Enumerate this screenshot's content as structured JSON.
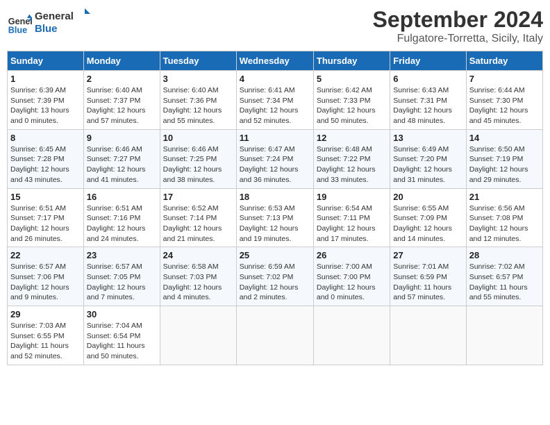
{
  "logo": {
    "line1": "General",
    "line2": "Blue"
  },
  "title": "September 2024",
  "location": "Fulgatore-Torretta, Sicily, Italy",
  "days_of_week": [
    "Sunday",
    "Monday",
    "Tuesday",
    "Wednesday",
    "Thursday",
    "Friday",
    "Saturday"
  ],
  "weeks": [
    [
      {
        "day": "1",
        "info": "Sunrise: 6:39 AM\nSunset: 7:39 PM\nDaylight: 13 hours\nand 0 minutes."
      },
      {
        "day": "2",
        "info": "Sunrise: 6:40 AM\nSunset: 7:37 PM\nDaylight: 12 hours\nand 57 minutes."
      },
      {
        "day": "3",
        "info": "Sunrise: 6:40 AM\nSunset: 7:36 PM\nDaylight: 12 hours\nand 55 minutes."
      },
      {
        "day": "4",
        "info": "Sunrise: 6:41 AM\nSunset: 7:34 PM\nDaylight: 12 hours\nand 52 minutes."
      },
      {
        "day": "5",
        "info": "Sunrise: 6:42 AM\nSunset: 7:33 PM\nDaylight: 12 hours\nand 50 minutes."
      },
      {
        "day": "6",
        "info": "Sunrise: 6:43 AM\nSunset: 7:31 PM\nDaylight: 12 hours\nand 48 minutes."
      },
      {
        "day": "7",
        "info": "Sunrise: 6:44 AM\nSunset: 7:30 PM\nDaylight: 12 hours\nand 45 minutes."
      }
    ],
    [
      {
        "day": "8",
        "info": "Sunrise: 6:45 AM\nSunset: 7:28 PM\nDaylight: 12 hours\nand 43 minutes."
      },
      {
        "day": "9",
        "info": "Sunrise: 6:46 AM\nSunset: 7:27 PM\nDaylight: 12 hours\nand 41 minutes."
      },
      {
        "day": "10",
        "info": "Sunrise: 6:46 AM\nSunset: 7:25 PM\nDaylight: 12 hours\nand 38 minutes."
      },
      {
        "day": "11",
        "info": "Sunrise: 6:47 AM\nSunset: 7:24 PM\nDaylight: 12 hours\nand 36 minutes."
      },
      {
        "day": "12",
        "info": "Sunrise: 6:48 AM\nSunset: 7:22 PM\nDaylight: 12 hours\nand 33 minutes."
      },
      {
        "day": "13",
        "info": "Sunrise: 6:49 AM\nSunset: 7:20 PM\nDaylight: 12 hours\nand 31 minutes."
      },
      {
        "day": "14",
        "info": "Sunrise: 6:50 AM\nSunset: 7:19 PM\nDaylight: 12 hours\nand 29 minutes."
      }
    ],
    [
      {
        "day": "15",
        "info": "Sunrise: 6:51 AM\nSunset: 7:17 PM\nDaylight: 12 hours\nand 26 minutes."
      },
      {
        "day": "16",
        "info": "Sunrise: 6:51 AM\nSunset: 7:16 PM\nDaylight: 12 hours\nand 24 minutes."
      },
      {
        "day": "17",
        "info": "Sunrise: 6:52 AM\nSunset: 7:14 PM\nDaylight: 12 hours\nand 21 minutes."
      },
      {
        "day": "18",
        "info": "Sunrise: 6:53 AM\nSunset: 7:13 PM\nDaylight: 12 hours\nand 19 minutes."
      },
      {
        "day": "19",
        "info": "Sunrise: 6:54 AM\nSunset: 7:11 PM\nDaylight: 12 hours\nand 17 minutes."
      },
      {
        "day": "20",
        "info": "Sunrise: 6:55 AM\nSunset: 7:09 PM\nDaylight: 12 hours\nand 14 minutes."
      },
      {
        "day": "21",
        "info": "Sunrise: 6:56 AM\nSunset: 7:08 PM\nDaylight: 12 hours\nand 12 minutes."
      }
    ],
    [
      {
        "day": "22",
        "info": "Sunrise: 6:57 AM\nSunset: 7:06 PM\nDaylight: 12 hours\nand 9 minutes."
      },
      {
        "day": "23",
        "info": "Sunrise: 6:57 AM\nSunset: 7:05 PM\nDaylight: 12 hours\nand 7 minutes."
      },
      {
        "day": "24",
        "info": "Sunrise: 6:58 AM\nSunset: 7:03 PM\nDaylight: 12 hours\nand 4 minutes."
      },
      {
        "day": "25",
        "info": "Sunrise: 6:59 AM\nSunset: 7:02 PM\nDaylight: 12 hours\nand 2 minutes."
      },
      {
        "day": "26",
        "info": "Sunrise: 7:00 AM\nSunset: 7:00 PM\nDaylight: 12 hours\nand 0 minutes."
      },
      {
        "day": "27",
        "info": "Sunrise: 7:01 AM\nSunset: 6:59 PM\nDaylight: 11 hours\nand 57 minutes."
      },
      {
        "day": "28",
        "info": "Sunrise: 7:02 AM\nSunset: 6:57 PM\nDaylight: 11 hours\nand 55 minutes."
      }
    ],
    [
      {
        "day": "29",
        "info": "Sunrise: 7:03 AM\nSunset: 6:55 PM\nDaylight: 11 hours\nand 52 minutes."
      },
      {
        "day": "30",
        "info": "Sunrise: 7:04 AM\nSunset: 6:54 PM\nDaylight: 11 hours\nand 50 minutes."
      },
      {
        "day": "",
        "info": ""
      },
      {
        "day": "",
        "info": ""
      },
      {
        "day": "",
        "info": ""
      },
      {
        "day": "",
        "info": ""
      },
      {
        "day": "",
        "info": ""
      }
    ]
  ]
}
